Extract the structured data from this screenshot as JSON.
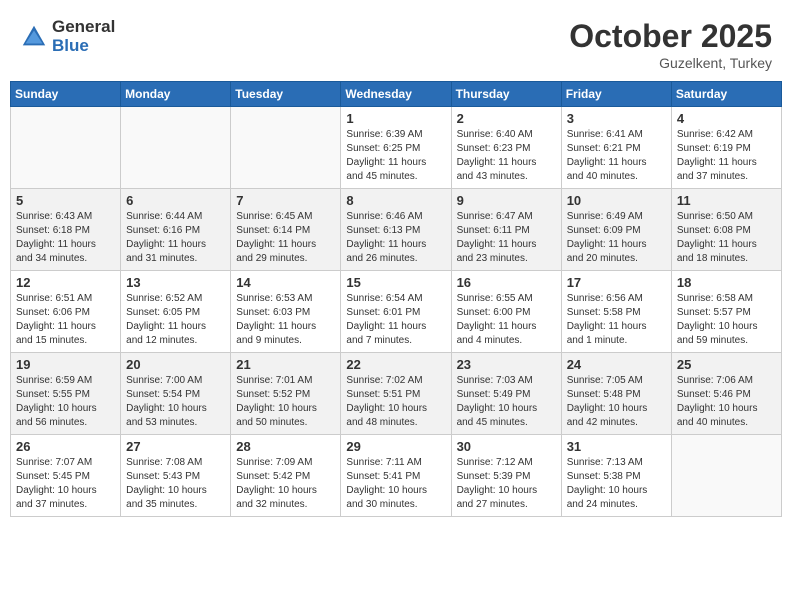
{
  "header": {
    "logo_general": "General",
    "logo_blue": "Blue",
    "month": "October 2025",
    "location": "Guzelkent, Turkey"
  },
  "weekdays": [
    "Sunday",
    "Monday",
    "Tuesday",
    "Wednesday",
    "Thursday",
    "Friday",
    "Saturday"
  ],
  "weeks": [
    {
      "alt": false,
      "days": [
        {
          "num": "",
          "info": ""
        },
        {
          "num": "",
          "info": ""
        },
        {
          "num": "",
          "info": ""
        },
        {
          "num": "1",
          "info": "Sunrise: 6:39 AM\nSunset: 6:25 PM\nDaylight: 11 hours\nand 45 minutes."
        },
        {
          "num": "2",
          "info": "Sunrise: 6:40 AM\nSunset: 6:23 PM\nDaylight: 11 hours\nand 43 minutes."
        },
        {
          "num": "3",
          "info": "Sunrise: 6:41 AM\nSunset: 6:21 PM\nDaylight: 11 hours\nand 40 minutes."
        },
        {
          "num": "4",
          "info": "Sunrise: 6:42 AM\nSunset: 6:19 PM\nDaylight: 11 hours\nand 37 minutes."
        }
      ]
    },
    {
      "alt": true,
      "days": [
        {
          "num": "5",
          "info": "Sunrise: 6:43 AM\nSunset: 6:18 PM\nDaylight: 11 hours\nand 34 minutes."
        },
        {
          "num": "6",
          "info": "Sunrise: 6:44 AM\nSunset: 6:16 PM\nDaylight: 11 hours\nand 31 minutes."
        },
        {
          "num": "7",
          "info": "Sunrise: 6:45 AM\nSunset: 6:14 PM\nDaylight: 11 hours\nand 29 minutes."
        },
        {
          "num": "8",
          "info": "Sunrise: 6:46 AM\nSunset: 6:13 PM\nDaylight: 11 hours\nand 26 minutes."
        },
        {
          "num": "9",
          "info": "Sunrise: 6:47 AM\nSunset: 6:11 PM\nDaylight: 11 hours\nand 23 minutes."
        },
        {
          "num": "10",
          "info": "Sunrise: 6:49 AM\nSunset: 6:09 PM\nDaylight: 11 hours\nand 20 minutes."
        },
        {
          "num": "11",
          "info": "Sunrise: 6:50 AM\nSunset: 6:08 PM\nDaylight: 11 hours\nand 18 minutes."
        }
      ]
    },
    {
      "alt": false,
      "days": [
        {
          "num": "12",
          "info": "Sunrise: 6:51 AM\nSunset: 6:06 PM\nDaylight: 11 hours\nand 15 minutes."
        },
        {
          "num": "13",
          "info": "Sunrise: 6:52 AM\nSunset: 6:05 PM\nDaylight: 11 hours\nand 12 minutes."
        },
        {
          "num": "14",
          "info": "Sunrise: 6:53 AM\nSunset: 6:03 PM\nDaylight: 11 hours\nand 9 minutes."
        },
        {
          "num": "15",
          "info": "Sunrise: 6:54 AM\nSunset: 6:01 PM\nDaylight: 11 hours\nand 7 minutes."
        },
        {
          "num": "16",
          "info": "Sunrise: 6:55 AM\nSunset: 6:00 PM\nDaylight: 11 hours\nand 4 minutes."
        },
        {
          "num": "17",
          "info": "Sunrise: 6:56 AM\nSunset: 5:58 PM\nDaylight: 11 hours\nand 1 minute."
        },
        {
          "num": "18",
          "info": "Sunrise: 6:58 AM\nSunset: 5:57 PM\nDaylight: 10 hours\nand 59 minutes."
        }
      ]
    },
    {
      "alt": true,
      "days": [
        {
          "num": "19",
          "info": "Sunrise: 6:59 AM\nSunset: 5:55 PM\nDaylight: 10 hours\nand 56 minutes."
        },
        {
          "num": "20",
          "info": "Sunrise: 7:00 AM\nSunset: 5:54 PM\nDaylight: 10 hours\nand 53 minutes."
        },
        {
          "num": "21",
          "info": "Sunrise: 7:01 AM\nSunset: 5:52 PM\nDaylight: 10 hours\nand 50 minutes."
        },
        {
          "num": "22",
          "info": "Sunrise: 7:02 AM\nSunset: 5:51 PM\nDaylight: 10 hours\nand 48 minutes."
        },
        {
          "num": "23",
          "info": "Sunrise: 7:03 AM\nSunset: 5:49 PM\nDaylight: 10 hours\nand 45 minutes."
        },
        {
          "num": "24",
          "info": "Sunrise: 7:05 AM\nSunset: 5:48 PM\nDaylight: 10 hours\nand 42 minutes."
        },
        {
          "num": "25",
          "info": "Sunrise: 7:06 AM\nSunset: 5:46 PM\nDaylight: 10 hours\nand 40 minutes."
        }
      ]
    },
    {
      "alt": false,
      "days": [
        {
          "num": "26",
          "info": "Sunrise: 7:07 AM\nSunset: 5:45 PM\nDaylight: 10 hours\nand 37 minutes."
        },
        {
          "num": "27",
          "info": "Sunrise: 7:08 AM\nSunset: 5:43 PM\nDaylight: 10 hours\nand 35 minutes."
        },
        {
          "num": "28",
          "info": "Sunrise: 7:09 AM\nSunset: 5:42 PM\nDaylight: 10 hours\nand 32 minutes."
        },
        {
          "num": "29",
          "info": "Sunrise: 7:11 AM\nSunset: 5:41 PM\nDaylight: 10 hours\nand 30 minutes."
        },
        {
          "num": "30",
          "info": "Sunrise: 7:12 AM\nSunset: 5:39 PM\nDaylight: 10 hours\nand 27 minutes."
        },
        {
          "num": "31",
          "info": "Sunrise: 7:13 AM\nSunset: 5:38 PM\nDaylight: 10 hours\nand 24 minutes."
        },
        {
          "num": "",
          "info": ""
        }
      ]
    }
  ]
}
